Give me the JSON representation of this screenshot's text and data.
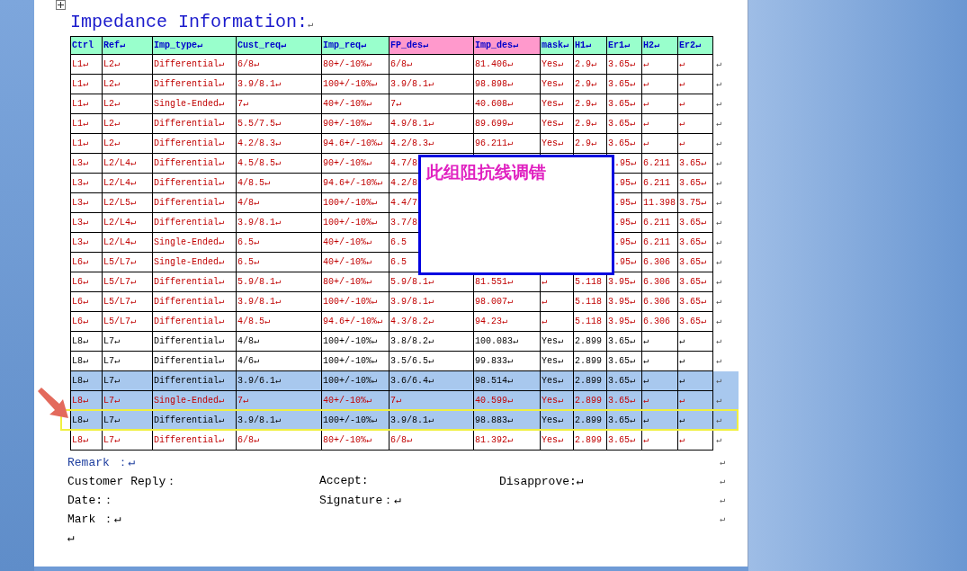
{
  "title": {
    "text": "Impedance Information:",
    "end_mark": "↵"
  },
  "columns": [
    {
      "label": "Ctrl",
      "color": "#99ffcc"
    },
    {
      "label": "Ref↵",
      "color": "#99ffcc"
    },
    {
      "label": "Imp_type↵",
      "color": "#99ffcc"
    },
    {
      "label": "Cust_req↵",
      "color": "#99ffcc"
    },
    {
      "label": "Imp_req↵",
      "color": "#99ffcc"
    },
    {
      "label": "FP_des↵",
      "color": "#ff99cc"
    },
    {
      "label": "Imp_des↵",
      "color": "#ff99cc"
    },
    {
      "label": "mask↵",
      "color": "#99ffcc"
    },
    {
      "label": "H1↵",
      "color": "#99ffcc"
    },
    {
      "label": "Er1↵",
      "color": "#99ffcc"
    },
    {
      "label": "H2↵",
      "color": "#99ffcc"
    },
    {
      "label": "Er2↵",
      "color": "#99ffcc"
    }
  ],
  "rows": [
    {
      "cells": [
        "L1↵",
        "L2↵",
        "Differential↵",
        "6/8↵",
        "80+/-10%↵",
        "6/8↵",
        "81.406↵",
        "Yes↵",
        "2.9↵",
        "3.65↵",
        "↵",
        "↵"
      ],
      "kind": "revised",
      "selected": false,
      "flagged": false,
      "under_note": false,
      "end_mark": "↵"
    },
    {
      "cells": [
        "L1↵",
        "L2↵",
        "Differential↵",
        "3.9/8.1↵",
        "100+/-10%↵",
        "3.9/8.1↵",
        "98.898↵",
        "Yes↵",
        "2.9↵",
        "3.65↵",
        "↵",
        "↵"
      ],
      "kind": "revised",
      "selected": false,
      "flagged": false,
      "under_note": false,
      "end_mark": "↵"
    },
    {
      "cells": [
        "L1↵",
        "L2↵",
        "Single-Ended↵",
        "7↵",
        "40+/-10%↵",
        "7↵",
        "40.608↵",
        "Yes↵",
        "2.9↵",
        "3.65↵",
        "↵",
        "↵"
      ],
      "kind": "revised",
      "selected": false,
      "flagged": false,
      "under_note": false,
      "end_mark": "↵"
    },
    {
      "cells": [
        "L1↵",
        "L2↵",
        "Differential↵",
        "5.5/7.5↵",
        "90+/-10%↵",
        "4.9/8.1↵",
        "89.699↵",
        "Yes↵",
        "2.9↵",
        "3.65↵",
        "↵",
        "↵"
      ],
      "kind": "revised",
      "selected": false,
      "flagged": false,
      "under_note": false,
      "end_mark": "↵"
    },
    {
      "cells": [
        "L1↵",
        "L2↵",
        "Differential↵",
        "4.2/8.3↵",
        "94.6+/-10%↵",
        "4.2/8.3↵",
        "96.211↵",
        "Yes↵",
        "2.9↵",
        "3.65↵",
        "↵",
        "↵"
      ],
      "kind": "revised",
      "selected": false,
      "flagged": false,
      "under_note": false,
      "end_mark": "↵"
    },
    {
      "cells": [
        "L3↵",
        "L2/L4↵",
        "Differential↵",
        "4.5/8.5↵",
        "90+/-10%↵",
        "4.7/8",
        null,
        null,
        null,
        ".95↵",
        "6.211",
        "3.65↵"
      ],
      "kind": "revised",
      "selected": false,
      "flagged": false,
      "under_note": true,
      "end_mark": "↵"
    },
    {
      "cells": [
        "L3↵",
        "L2/L4↵",
        "Differential↵",
        "4/8.5↵",
        "94.6+/-10%↵",
        "4.2/8",
        null,
        null,
        null,
        ".95↵",
        "6.211",
        "3.65↵"
      ],
      "kind": "revised",
      "selected": false,
      "flagged": false,
      "under_note": true,
      "end_mark": "↵"
    },
    {
      "cells": [
        "L3↵",
        "L2/L5↵",
        "Differential↵",
        "4/8↵",
        "100+/-10%↵",
        "4.4/7",
        null,
        null,
        null,
        ".95↵",
        "11.398",
        "3.75↵"
      ],
      "kind": "revised",
      "selected": false,
      "flagged": false,
      "under_note": true,
      "end_mark": "↵"
    },
    {
      "cells": [
        "L3↵",
        "L2/L4↵",
        "Differential↵",
        "3.9/8.1↵",
        "100+/-10%↵",
        "3.7/8",
        null,
        null,
        null,
        ".95↵",
        "6.211",
        "3.65↵"
      ],
      "kind": "revised",
      "selected": false,
      "flagged": false,
      "under_note": true,
      "end_mark": "↵"
    },
    {
      "cells": [
        "L3↵",
        "L2/L4↵",
        "Single-Ended↵",
        "6.5↵",
        "40+/-10%↵",
        "6.5",
        null,
        null,
        null,
        ".95↵",
        "6.211",
        "3.65↵"
      ],
      "kind": "revised",
      "selected": false,
      "flagged": false,
      "under_note": true,
      "end_mark": "↵"
    },
    {
      "cells": [
        "L6↵",
        "L5/L7↵",
        "Single-Ended↵",
        "6.5↵",
        "40+/-10%↵",
        "6.5",
        null,
        null,
        null,
        ".95↵",
        "6.306",
        "3.65↵"
      ],
      "kind": "revised",
      "selected": false,
      "flagged": false,
      "under_note": true,
      "end_mark": "↵"
    },
    {
      "cells": [
        "L6↵",
        "L5/L7↵",
        "Differential↵",
        "5.9/8.1↵",
        "80+/-10%↵",
        "5.9/8.1↵",
        "81.551↵",
        "↵",
        "5.118",
        "3.95↵",
        "6.306",
        "3.65↵"
      ],
      "kind": "revised",
      "selected": false,
      "flagged": false,
      "under_note": false,
      "end_mark": "↵"
    },
    {
      "cells": [
        "L6↵",
        "L5/L7↵",
        "Differential↵",
        "3.9/8.1↵",
        "100+/-10%↵",
        "3.9/8.1↵",
        "98.007↵",
        "↵",
        "5.118",
        "3.95↵",
        "6.306",
        "3.65↵"
      ],
      "kind": "revised",
      "selected": false,
      "flagged": false,
      "under_note": false,
      "end_mark": "↵"
    },
    {
      "cells": [
        "L6↵",
        "L5/L7↵",
        "Differential↵",
        "4/8.5↵",
        "94.6+/-10%↵",
        "4.3/8.2↵",
        "94.23↵",
        "↵",
        "5.118",
        "3.95↵",
        "6.306",
        "3.65↵"
      ],
      "kind": "revised",
      "selected": false,
      "flagged": false,
      "under_note": false,
      "end_mark": "↵"
    },
    {
      "cells": [
        "L8↵",
        "L7↵",
        "Differential↵",
        "4/8↵",
        "100+/-10%↵",
        "3.8/8.2↵",
        "100.083↵",
        "Yes↵",
        "2.899",
        "3.65↵",
        "↵",
        "↵"
      ],
      "kind": "plain",
      "selected": false,
      "flagged": false,
      "under_note": false,
      "end_mark": "↵"
    },
    {
      "cells": [
        "L8↵",
        "L7↵",
        "Differential↵",
        "4/6↵",
        "100+/-10%↵",
        "3.5/6.5↵",
        "99.833↵",
        "Yes↵",
        "2.899",
        "3.65↵",
        "↵",
        "↵"
      ],
      "kind": "plain",
      "selected": false,
      "flagged": false,
      "under_note": false,
      "end_mark": "↵"
    },
    {
      "cells": [
        "L8↵",
        "L7↵",
        "Differential↵",
        "3.9/6.1↵",
        "100+/-10%↵",
        "3.6/6.4↵",
        "98.514↵",
        "Yes↵",
        "2.899",
        "3.65↵",
        "↵",
        "↵"
      ],
      "kind": "plain",
      "selected": true,
      "flagged": false,
      "under_note": false,
      "end_mark": "↵"
    },
    {
      "cells": [
        "L8↵",
        "L7↵",
        "Single-Ended↵",
        "7↵",
        "40+/-10%↵",
        "7↵",
        "40.599↵",
        "Yes↵",
        "2.899",
        "3.65↵",
        "↵",
        "↵"
      ],
      "kind": "revised",
      "selected": true,
      "flagged": false,
      "under_note": false,
      "end_mark": "↵"
    },
    {
      "cells": [
        "L8↵",
        "L7↵",
        "Differential↵",
        "3.9/8.1↵",
        "100+/-10%↵",
        "3.9/8.1↵",
        "98.883↵",
        "Yes↵",
        "2.899",
        "3.65↵",
        "↵",
        "↵"
      ],
      "kind": "plain",
      "selected": true,
      "flagged": true,
      "under_note": false,
      "end_mark": "↵"
    },
    {
      "cells": [
        "L8↵",
        "L7↵",
        "Differential↵",
        "6/8↵",
        "80+/-10%↵",
        "6/8↵",
        "81.392↵",
        "Yes↵",
        "2.899",
        "3.65↵",
        "↵",
        "↵"
      ],
      "kind": "revised",
      "selected": false,
      "flagged": false,
      "under_note": false,
      "end_mark": "↵"
    }
  ],
  "note": {
    "text": "此组阻抗线调错"
  },
  "footer_lines": [
    {
      "parts": [
        {
          "text": "Remark ：↵",
          "kind": "label"
        }
      ],
      "end_mark": "↵"
    },
    {
      "parts": [
        {
          "text": "Customer Reply：",
          "kind": "text"
        },
        {
          "text": "Accept:",
          "kind": "text"
        },
        {
          "text": "Disapprove:↵",
          "kind": "text"
        }
      ],
      "end_mark": "↵"
    },
    {
      "parts": [
        {
          "text": "Date:：",
          "kind": "text"
        },
        {
          "text": "Signature：↵",
          "kind": "text"
        }
      ],
      "end_mark": "↵"
    },
    {
      "parts": [
        {
          "text": "Mark ：↵",
          "kind": "text"
        }
      ],
      "end_mark": "↵"
    },
    {
      "parts": [
        {
          "text": "↵",
          "kind": "text"
        }
      ]
    }
  ]
}
